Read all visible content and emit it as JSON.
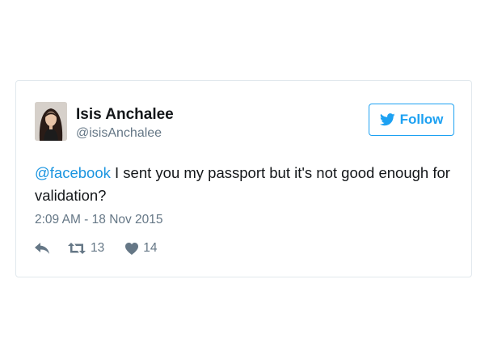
{
  "tweet": {
    "user": {
      "display_name": "Isis Anchalee",
      "handle": "@isisAnchalee",
      "avatar_icon": "profile-photo"
    },
    "follow": {
      "label": "Follow",
      "icon": "twitter-bird-icon"
    },
    "text": {
      "mention": "@facebook",
      "body": " I sent you my passport but it's not good enough for validation?"
    },
    "timestamp": "2:09 AM - 18 Nov 2015",
    "actions": {
      "reply_icon": "reply-icon",
      "retweet_icon": "retweet-icon",
      "retweet_count": "13",
      "like_icon": "heart-icon",
      "like_count": "14"
    }
  },
  "colors": {
    "accent": "#1da1f2",
    "mention": "#1b95e0",
    "text_primary": "#14171a",
    "text_secondary": "#657786",
    "border": "#e1e8ed"
  }
}
